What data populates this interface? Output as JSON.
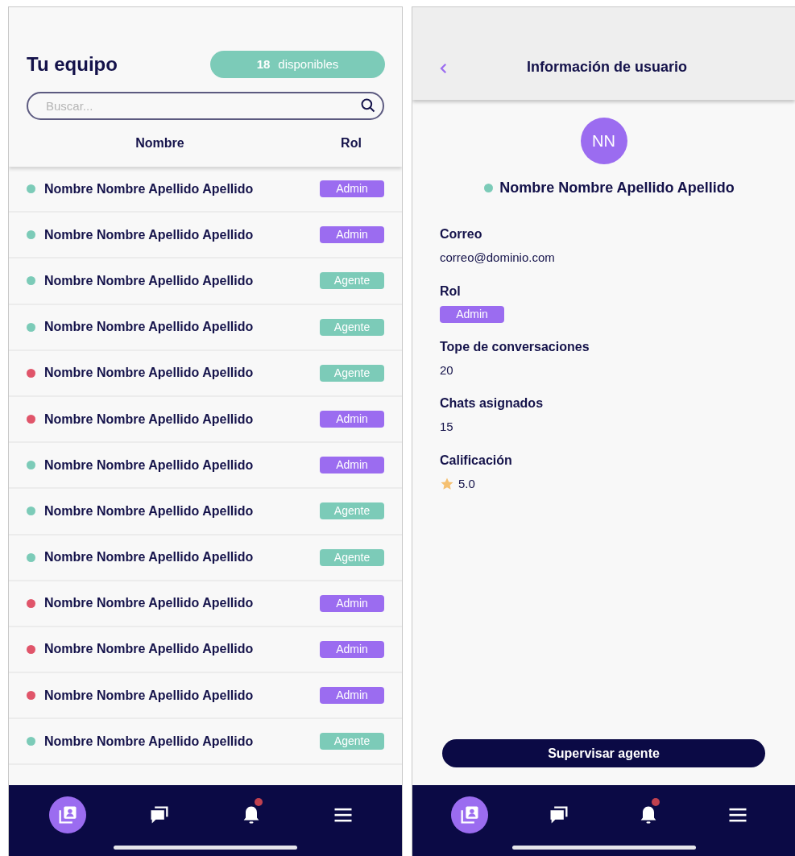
{
  "team_screen": {
    "title": "Tu equipo",
    "available": {
      "count": "18",
      "label": "disponibles"
    },
    "search": {
      "placeholder": "Buscar..."
    },
    "columns": [
      "Nombre",
      "Rol"
    ],
    "rows": [
      {
        "name": "Nombre Nombre Apellido Apellido",
        "color": "#7ccbb8",
        "role": {
          "label": "Admin",
          "color": "#9b6cf0"
        }
      },
      {
        "name": "Nombre Nombre Apellido Apellido",
        "color": "#7ccbb8",
        "role": {
          "label": "Admin",
          "color": "#9b6cf0"
        }
      },
      {
        "name": "Nombre Nombre Apellido Apellido",
        "color": "#7ccbb8",
        "role": {
          "label": "Agente",
          "color": "#7ccbb8"
        }
      },
      {
        "name": "Nombre Nombre Apellido Apellido",
        "color": "#7ccbb8",
        "role": {
          "label": "Agente",
          "color": "#7ccbb8"
        }
      },
      {
        "name": "Nombre Nombre Apellido Apellido",
        "color": "#e0556a",
        "role": {
          "label": "Agente",
          "color": "#7ccbb8"
        }
      },
      {
        "name": "Nombre Nombre Apellido Apellido",
        "color": "#e0556a",
        "role": {
          "label": "Admin",
          "color": "#9b6cf0"
        }
      },
      {
        "name": "Nombre Nombre Apellido Apellido",
        "color": "#7ccbb8",
        "role": {
          "label": "Admin",
          "color": "#9b6cf0"
        }
      },
      {
        "name": "Nombre Nombre Apellido Apellido",
        "color": "#7ccbb8",
        "role": {
          "label": "Agente",
          "color": "#7ccbb8"
        }
      },
      {
        "name": "Nombre Nombre Apellido Apellido",
        "color": "#7ccbb8",
        "role": {
          "label": "Agente",
          "color": "#7ccbb8"
        }
      },
      {
        "name": "Nombre Nombre Apellido Apellido",
        "color": "#e0556a",
        "role": {
          "label": "Admin",
          "color": "#9b6cf0"
        }
      },
      {
        "name": "Nombre Nombre Apellido Apellido",
        "color": "#e0556a",
        "role": {
          "label": "Admin",
          "color": "#9b6cf0"
        }
      },
      {
        "name": "Nombre Nombre Apellido Apellido",
        "color": "#e0556a",
        "role": {
          "label": "Admin",
          "color": "#9b6cf0"
        }
      },
      {
        "name": "Nombre Nombre Apellido Apellido",
        "color": "#7ccbb8",
        "role": {
          "label": "Agente",
          "color": "#7ccbb8"
        }
      }
    ],
    "nav": [
      {
        "kind": "contacts",
        "selected": true,
        "badge": false
      },
      {
        "kind": "chats",
        "selected": false,
        "badge": false
      },
      {
        "kind": "bell",
        "selected": false,
        "badge": true
      },
      {
        "kind": "menu",
        "selected": false,
        "badge": false
      }
    ]
  },
  "user_screen": {
    "title": "Información de usuario",
    "avatar": "NN",
    "name": "Nombre Nombre Apellido Apellido",
    "status": {
      "color": "#7ccbb8"
    },
    "fields": [
      {
        "kind": "text",
        "label": "Correo",
        "value": "correo@dominio.com"
      },
      {
        "kind": "badge",
        "label": "Rol",
        "value": "Admin",
        "color": "#9b6cf0"
      },
      {
        "kind": "text",
        "label": "Tope de conversaciones",
        "value": "20"
      },
      {
        "kind": "text",
        "label": "Chats asignados",
        "value": "15"
      },
      {
        "kind": "rating",
        "label": "Calificación",
        "value": "5.0"
      }
    ],
    "button": "Supervisar agente",
    "nav": [
      {
        "kind": "contacts",
        "selected": true,
        "badge": false
      },
      {
        "kind": "chats",
        "selected": false,
        "badge": false
      },
      {
        "kind": "bell",
        "selected": false,
        "badge": true
      },
      {
        "kind": "menu",
        "selected": false,
        "badge": false
      }
    ]
  }
}
